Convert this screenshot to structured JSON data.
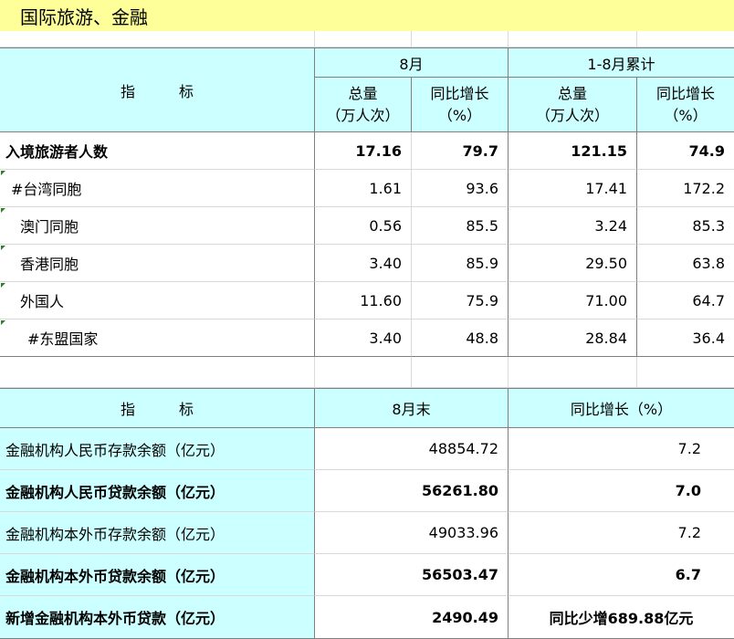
{
  "title": "国际旅游、金融",
  "tourism": {
    "header": {
      "indicator": "指　　　标",
      "period1": "8月",
      "period2": "1-8月累计",
      "total": "总量",
      "total_unit": "（万人次）",
      "growth": "同比增长",
      "growth_unit": "（%）"
    },
    "rows": [
      {
        "label": "入境旅游者人数",
        "v1": "17.16",
        "g1": "79.7",
        "v2": "121.15",
        "g2": "74.9",
        "bold": true
      },
      {
        "label": "#台湾同胞",
        "v1": "1.61",
        "g1": "93.6",
        "v2": "17.41",
        "g2": "172.2"
      },
      {
        "label": "澳门同胞",
        "v1": "0.56",
        "g1": "85.5",
        "v2": "3.24",
        "g2": "85.3"
      },
      {
        "label": "香港同胞",
        "v1": "3.40",
        "g1": "85.9",
        "v2": "29.50",
        "g2": "63.8"
      },
      {
        "label": "外国人",
        "v1": "11.60",
        "g1": "75.9",
        "v2": "71.00",
        "g2": "64.7"
      },
      {
        "label": "#东盟国家",
        "v1": "3.40",
        "g1": "48.8",
        "v2": "28.84",
        "g2": "36.4"
      }
    ]
  },
  "finance": {
    "header": {
      "indicator": "指　　　标",
      "month_end": "8月末",
      "growth": "同比增长（%）"
    },
    "rows": [
      {
        "label": "金融机构人民币存款余额（亿元）",
        "value": "48854.72",
        "growth": "7.2"
      },
      {
        "label": "金融机构人民币贷款余额（亿元）",
        "value": "56261.80",
        "growth": "7.0",
        "bold": true
      },
      {
        "label": "金融机构本外币存款余额（亿元）",
        "value": "49033.96",
        "growth": "7.2"
      },
      {
        "label": "金融机构本外币贷款余额（亿元）",
        "value": "56503.47",
        "growth": "6.7",
        "bold": true
      },
      {
        "label": "新增金融机构本外币贷款（亿元）",
        "value": "2490.49",
        "growth": "同比少增689.88亿元",
        "bold": true
      }
    ]
  },
  "colors": {
    "header_bg": "#ccffff",
    "title_bg": "#ffff99",
    "border": "#7f7f7f"
  }
}
